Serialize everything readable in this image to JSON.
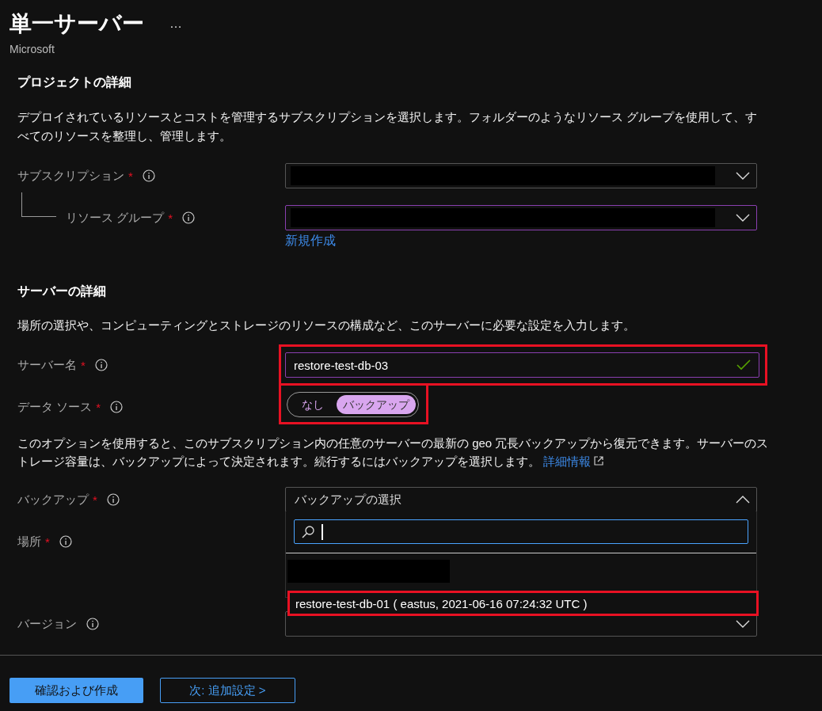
{
  "header": {
    "title": "単一サーバー",
    "more": "…",
    "publisher": "Microsoft"
  },
  "sections": [
    {
      "heading": "プロジェクトの詳細",
      "description": "デプロイされているリソースとコストを管理するサブスクリプションを選択します。フォルダーのようなリソース グループを使用して、すべてのリソースを整理し、管理します。",
      "fields": [
        {
          "kind": "dropdown",
          "label": "サブスクリプション",
          "required_mark": "*",
          "redacted": true,
          "focused": false,
          "children": [
            {
              "kind": "dropdown",
              "label": "リソース グループ",
              "required_mark": "*",
              "redacted": true,
              "focused": true,
              "link": "新規作成"
            }
          ]
        }
      ]
    },
    {
      "heading": "サーバーの詳細",
      "description": "場所の選択や、コンピューティングとストレージのリソースの構成など、このサーバーに必要な設定を入力します。",
      "fields": [
        {
          "kind": "text",
          "label": "サーバー名",
          "required_mark": "*",
          "value": "restore-test-db-03",
          "focused": true,
          "valid": true,
          "highlighted": true
        },
        {
          "kind": "toggle",
          "label": "データ ソース",
          "required_mark": "*",
          "highlighted": true,
          "options": [
            {
              "label": "なし",
              "selected": false
            },
            {
              "label": "バックアップ",
              "selected": true
            }
          ]
        },
        {
          "kind": "note",
          "text": "このオプションを使用すると、このサブスクリプション内の任意のサーバーの最新の geo 冗長バックアップから復元できます。サーバーのストレージ容量は、バックアップによって決定されます。続行するにはバックアップを選択します。",
          "link": "詳細情報"
        },
        {
          "kind": "dropdown",
          "label": "バックアップ",
          "required_mark": "*",
          "value": "バックアップの選択",
          "expanded": true,
          "focused": false,
          "list": {
            "search": {
              "focused": true
            },
            "options": [
              {
                "redacted": true
              },
              {
                "label": "restore-test-db-01 ( eastus, 2021-06-16 07:24:32 UTC )",
                "highlighted": true
              }
            ]
          }
        },
        {
          "kind": "covered",
          "label": "場所",
          "required_mark": "*"
        },
        {
          "kind": "dropdown",
          "label": "バージョン",
          "focused": false
        }
      ]
    }
  ],
  "footer": {
    "buttons": [
      {
        "label": "確認および作成",
        "kind": "primary"
      },
      {
        "label": "次: 追加設定 >",
        "kind": "secondary"
      }
    ]
  }
}
